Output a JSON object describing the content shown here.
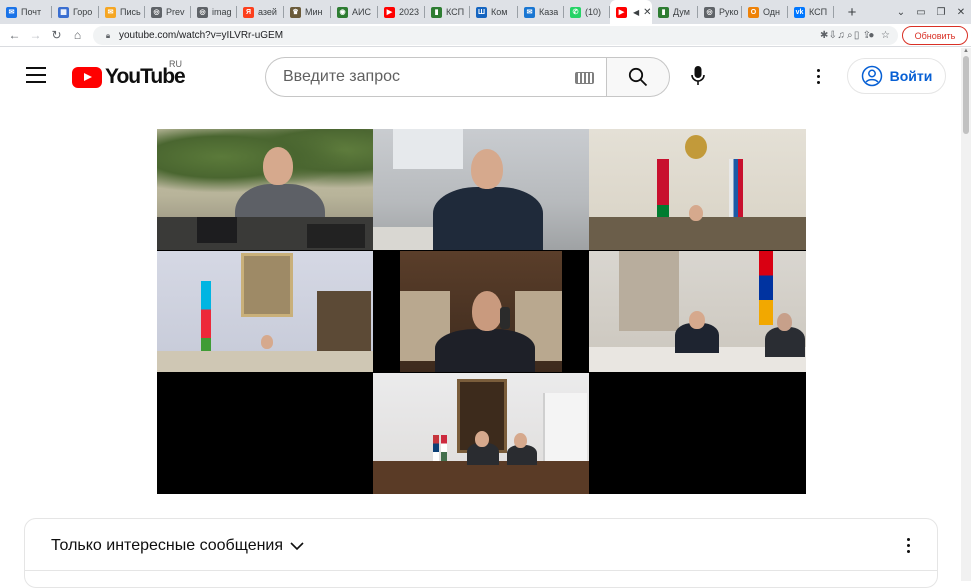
{
  "browser": {
    "tabs": [
      {
        "label": "Почт",
        "icon": "mail-icon",
        "color": "#1a73e8",
        "glyph": "✉"
      },
      {
        "label": "Горо",
        "icon": "city-icon",
        "color": "#3b6fd1",
        "glyph": "▦"
      },
      {
        "label": "Пись",
        "icon": "mail-ru-icon",
        "color": "#f5a623",
        "glyph": "✉"
      },
      {
        "label": "Prev",
        "icon": "globe-icon",
        "color": "#5f6368",
        "glyph": "◎"
      },
      {
        "label": "imag",
        "icon": "globe-icon",
        "color": "#5f6368",
        "glyph": "◎"
      },
      {
        "label": "азей",
        "icon": "yandex-icon",
        "color": "#fc3f1d",
        "glyph": "Я"
      },
      {
        "label": "Мин",
        "icon": "emblem-icon",
        "color": "#6b5b3a",
        "glyph": "♛"
      },
      {
        "label": "АИС",
        "icon": "ais-icon",
        "color": "#2e7d32",
        "glyph": "◉"
      },
      {
        "label": "2023",
        "icon": "youtube-icon",
        "color": "#ff0000",
        "glyph": "▶"
      },
      {
        "label": "КСП",
        "icon": "ksp-icon",
        "color": "#2e7d32",
        "glyph": "▮"
      },
      {
        "label": "Ком",
        "icon": "km-icon",
        "color": "#1565c0",
        "glyph": "Ш"
      },
      {
        "label": "Каза",
        "icon": "kazan-icon",
        "color": "#1976d2",
        "glyph": "✉"
      },
      {
        "label": "(10)",
        "icon": "whatsapp-icon",
        "color": "#25d366",
        "glyph": "✆"
      },
      {
        "label": "",
        "icon": "youtube-icon",
        "color": "#ff0000",
        "glyph": "▶",
        "active": true
      },
      {
        "label": "Дум",
        "icon": "duma-icon",
        "color": "#2e7d32",
        "glyph": "▮"
      },
      {
        "label": "Руко",
        "icon": "globe-icon",
        "color": "#5f6368",
        "glyph": "◎"
      },
      {
        "label": "Одн",
        "icon": "odnoklassniki-icon",
        "color": "#ee8208",
        "glyph": "О"
      },
      {
        "label": "КСП",
        "icon": "vk-icon",
        "color": "#0077ff",
        "glyph": "vk"
      }
    ],
    "new_tab_glyph": "+",
    "window_controls": [
      "⌄",
      "▭",
      "❐",
      "✕"
    ],
    "nav": {
      "back": "←",
      "forward": "→",
      "reload": "↻",
      "home": "⌂"
    },
    "url": "youtube.com/watch?v=yILVRr-uGEM",
    "update_button": "Обновить"
  },
  "youtube": {
    "logo_text": "YouTube",
    "region": "RU",
    "search_placeholder": "Введите запрос",
    "signin_label": "Войти"
  },
  "chat": {
    "title": "Только интересные сообщения"
  },
  "colors": {
    "brand_red": "#ff0000",
    "link_blue": "#065fd4",
    "update_red": "#d93025"
  }
}
